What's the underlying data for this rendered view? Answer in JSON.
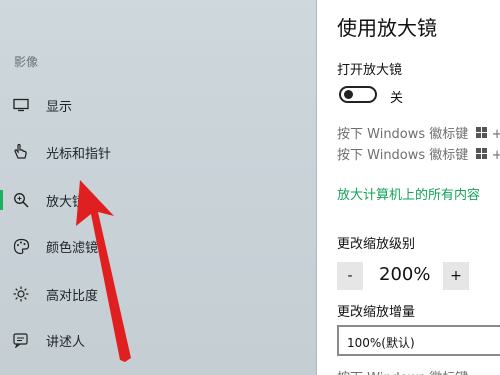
{
  "sidebar": {
    "section_title": "影像",
    "items": [
      {
        "label": "显示",
        "icon": "monitor-icon"
      },
      {
        "label": "光标和指针",
        "icon": "pointer-hand-icon"
      },
      {
        "label": "放大镜",
        "icon": "magnifier-icon",
        "active": true
      },
      {
        "label": "颜色滤镜",
        "icon": "palette-icon"
      },
      {
        "label": "高对比度",
        "icon": "sun-icon"
      },
      {
        "label": "讲述人",
        "icon": "narrator-icon"
      }
    ]
  },
  "main": {
    "title": "使用放大镜",
    "open_magnifier_label": "打开放大镜",
    "toggle_state": "关",
    "shortcut1": "按下 Windows 徽标键",
    "shortcut2": "按下 Windows 徽标键",
    "shortcut_suffix": "+",
    "link": "放大计算机上的所有内容",
    "zoom_level_label": "更改缩放级别",
    "minus_label": "-",
    "zoom_value": "200%",
    "plus_label": "+",
    "increment_label": "更改缩放增量",
    "increment_value": "100%(默认)",
    "cut_text": "按下 Windows 徽标键"
  },
  "colors": {
    "accent": "#1fb05f",
    "link": "#13a35a",
    "arrow": "#e02020"
  }
}
